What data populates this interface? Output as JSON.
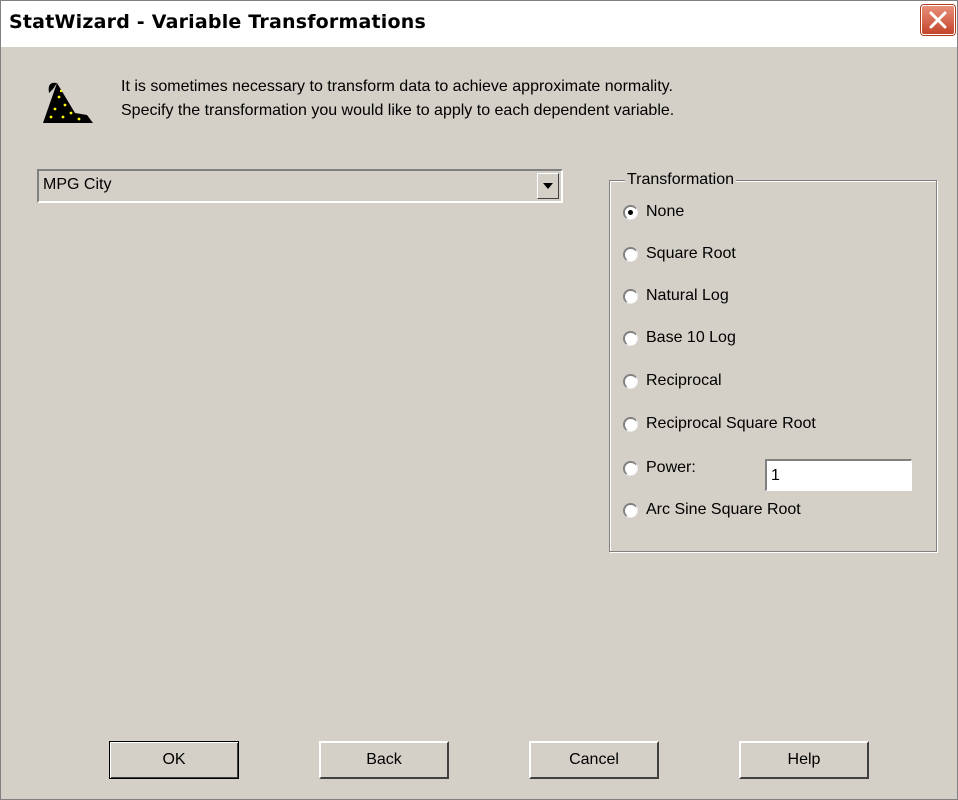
{
  "window": {
    "title": "StatWizard - Variable Transformations",
    "close_icon": "close-icon"
  },
  "intro": {
    "icon": "wizard-hat-icon",
    "line1": "It is sometimes necessary to transform data to achieve approximate normality.",
    "line2": "Specify the transformation you would like to apply to each dependent variable."
  },
  "variable_select": {
    "value": "MPG City",
    "dropdown_icon": "chevron-down-icon"
  },
  "transformation": {
    "group_label": "Transformation",
    "selected": "None",
    "options": [
      {
        "label": "None",
        "checked": true
      },
      {
        "label": "Square Root",
        "checked": false
      },
      {
        "label": "Natural Log",
        "checked": false
      },
      {
        "label": "Base 10 Log",
        "checked": false
      },
      {
        "label": "Reciprocal",
        "checked": false
      },
      {
        "label": "Reciprocal Square Root",
        "checked": false
      },
      {
        "label": "Power:",
        "checked": false
      },
      {
        "label": "Arc Sine Square Root",
        "checked": false
      }
    ],
    "power_value": "1"
  },
  "buttons": {
    "ok": "OK",
    "back": "Back",
    "cancel": "Cancel",
    "help": "Help"
  },
  "colors": {
    "dialog_bg": "#d4d0c8",
    "close_button": "#c4442a"
  }
}
